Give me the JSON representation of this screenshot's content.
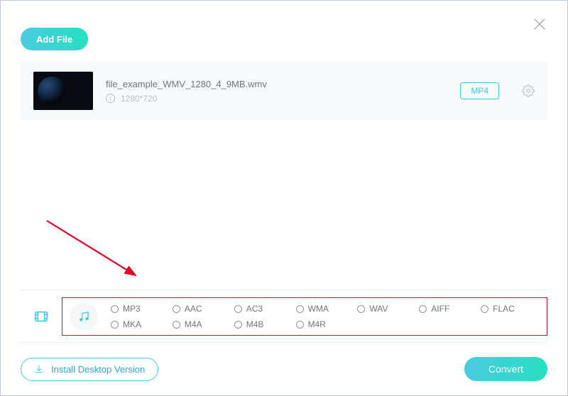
{
  "header": {
    "add_file_label": "Add File"
  },
  "file": {
    "name": "file_example_WMV_1280_4_9MB.wmv",
    "resolution": "1280*720",
    "output_format": "MP4"
  },
  "audio_formats": {
    "row1": [
      {
        "label": "MP3"
      },
      {
        "label": "AAC"
      },
      {
        "label": "AC3"
      },
      {
        "label": "WMA"
      },
      {
        "label": "WAV"
      },
      {
        "label": "AIFF"
      },
      {
        "label": "FLAC"
      }
    ],
    "row2": [
      {
        "label": "MKA"
      },
      {
        "label": "M4A"
      },
      {
        "label": "M4B"
      },
      {
        "label": "M4R"
      }
    ]
  },
  "footer": {
    "install_label": "Install Desktop Version",
    "convert_label": "Convert"
  }
}
